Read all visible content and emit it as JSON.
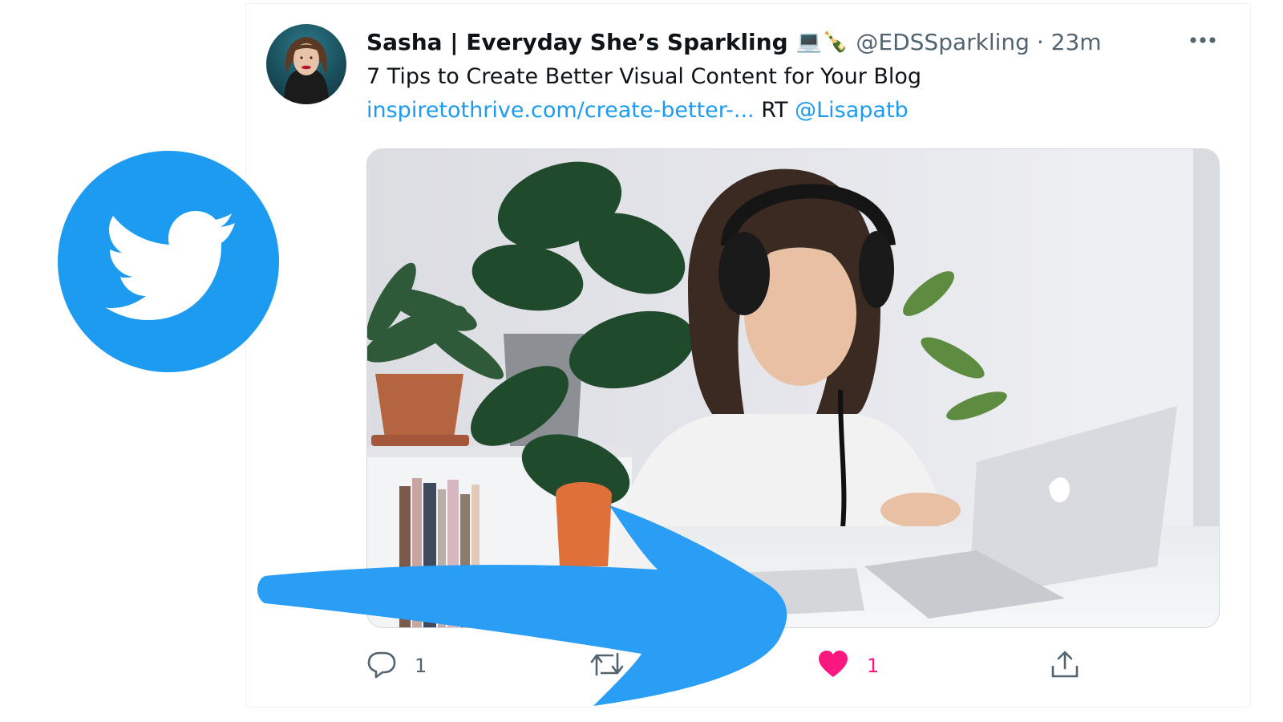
{
  "tweet": {
    "author_name": "Sasha | Everyday She’s Sparkling",
    "author_emojis": "💻🍾",
    "handle_time": "@EDSSparkling · 23m",
    "text": "7 Tips to Create Better Visual Content for Your Blog",
    "link": "inspiretothrive.com/create-better-...",
    "rt_label": "RT",
    "mention": "@Lisapatb"
  },
  "actions": {
    "reply_count": "1",
    "like_count": "1"
  },
  "icons": {
    "more": "more-horizontal-icon",
    "reply": "reply-icon",
    "retweet": "retweet-icon",
    "like": "heart-icon",
    "share": "share-icon",
    "logo": "twitter-bird-icon"
  },
  "colors": {
    "brand_blue": "#1d9bf0",
    "like_pink": "#f91880",
    "secondary_text": "#536471",
    "arrow_blue": "#2a9df4"
  }
}
